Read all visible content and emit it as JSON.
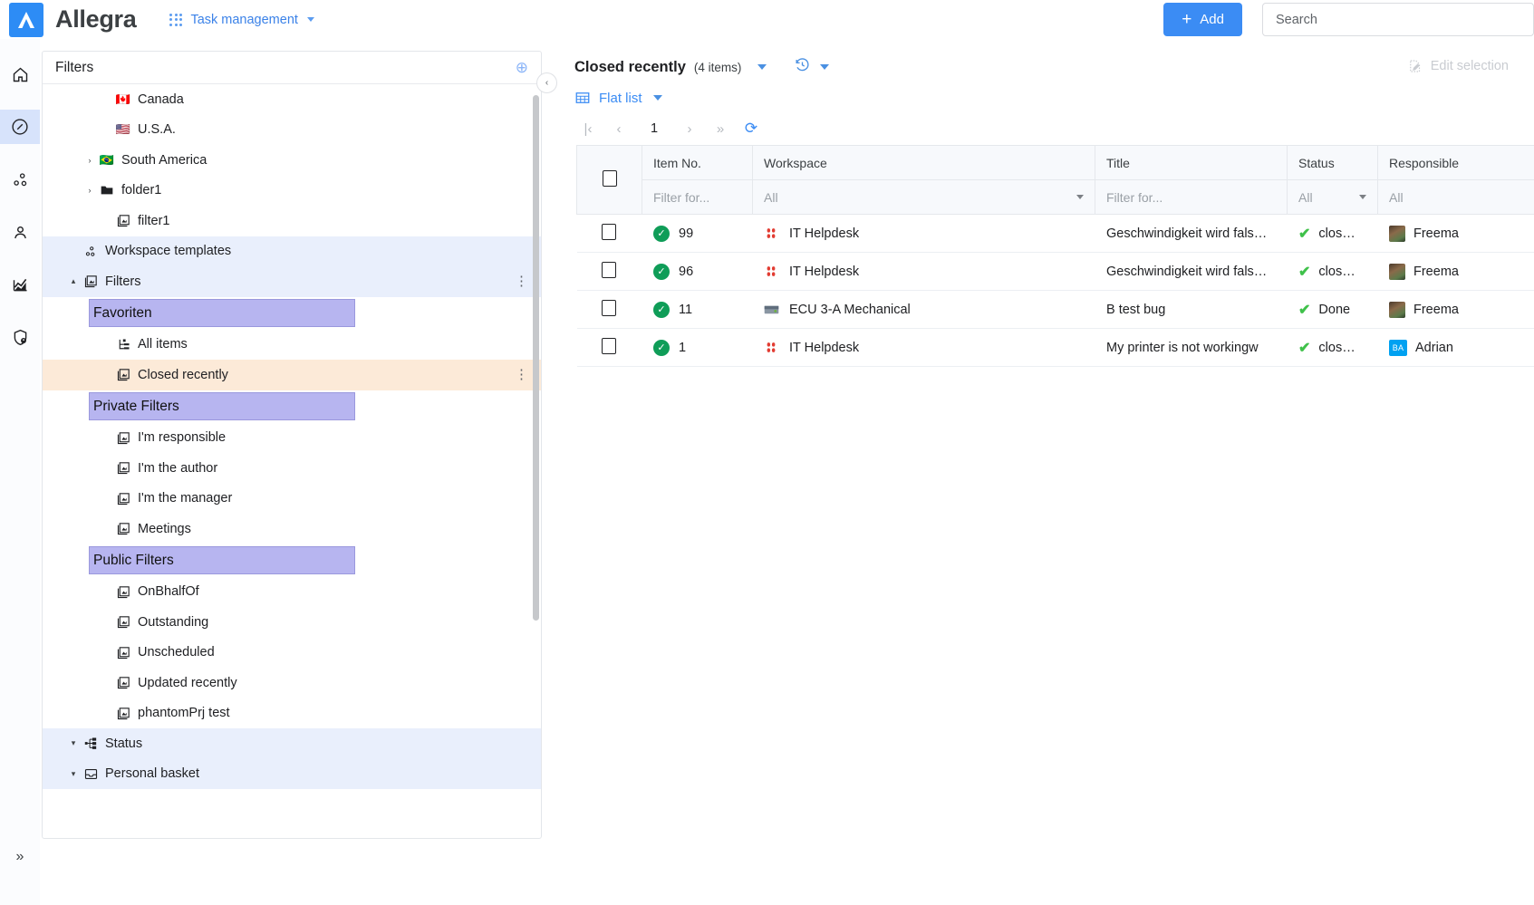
{
  "topbar": {
    "brand": "Allegra",
    "app_switcher_label": "Task management",
    "add_label": "Add",
    "add_plus": "+",
    "search_placeholder": "Search",
    "accent": "#3b8cf4"
  },
  "rail": {
    "items": [
      {
        "name": "home-icon",
        "label": "Home"
      },
      {
        "name": "compass-icon",
        "label": "Navigator",
        "active": true
      },
      {
        "name": "workflow-icon",
        "label": "Workspaces"
      },
      {
        "name": "person-icon",
        "label": "People"
      },
      {
        "name": "chart-icon",
        "label": "Reports"
      },
      {
        "name": "shield-icon",
        "label": "Admin"
      }
    ],
    "expand_glyph": "»"
  },
  "sidebar": {
    "title": "Filters",
    "add_glyph": "⊕",
    "collapse_glyph": "‹",
    "tree": [
      {
        "label": "Canada",
        "icon": "flag-canada",
        "indent": 3,
        "arrow": "",
        "type": "item"
      },
      {
        "label": "U.S.A.",
        "icon": "flag-usa",
        "indent": 3,
        "arrow": "",
        "type": "item"
      },
      {
        "label": "South America",
        "icon": "flag-brazil",
        "indent": 2,
        "arrow": "›",
        "type": "item"
      },
      {
        "label": "folder1",
        "icon": "folder-icon",
        "indent": 2,
        "arrow": "›",
        "type": "item"
      },
      {
        "label": "filter1",
        "icon": "filter-icon",
        "indent": 3,
        "arrow": "",
        "type": "item"
      },
      {
        "label": "Workspace templates",
        "icon": "templates-icon",
        "indent": 1,
        "arrow": "",
        "type": "group"
      },
      {
        "label": "Filters",
        "icon": "filter-icon",
        "indent": 1,
        "arrow": "▴",
        "type": "group",
        "menu": "⋮"
      },
      {
        "label": "Favoriten",
        "icon": "",
        "indent": 0,
        "arrow": "",
        "type": "chip"
      },
      {
        "label": "All items",
        "icon": "allitems-icon",
        "indent": 3,
        "arrow": "",
        "type": "item"
      },
      {
        "label": "Closed recently",
        "icon": "filter-icon",
        "indent": 3,
        "arrow": "",
        "type": "selected",
        "menu": "⋮"
      },
      {
        "label": "Private Filters",
        "icon": "",
        "indent": 0,
        "arrow": "",
        "type": "chip"
      },
      {
        "label": "I'm responsible",
        "icon": "filter-icon",
        "indent": 3,
        "arrow": "",
        "type": "item"
      },
      {
        "label": "I'm the author",
        "icon": "filter-icon",
        "indent": 3,
        "arrow": "",
        "type": "item"
      },
      {
        "label": "I'm the manager",
        "icon": "filter-icon",
        "indent": 3,
        "arrow": "",
        "type": "item"
      },
      {
        "label": "Meetings",
        "icon": "filter-icon",
        "indent": 3,
        "arrow": "",
        "type": "item"
      },
      {
        "label": "Public Filters",
        "icon": "",
        "indent": 0,
        "arrow": "",
        "type": "chip"
      },
      {
        "label": "OnBhalfOf",
        "icon": "filter-icon",
        "indent": 3,
        "arrow": "",
        "type": "item"
      },
      {
        "label": "Outstanding",
        "icon": "filter-icon",
        "indent": 3,
        "arrow": "",
        "type": "item"
      },
      {
        "label": "Unscheduled",
        "icon": "filter-icon",
        "indent": 3,
        "arrow": "",
        "type": "item"
      },
      {
        "label": "Updated recently",
        "icon": "filter-icon",
        "indent": 3,
        "arrow": "",
        "type": "item"
      },
      {
        "label": "phantomPrj test",
        "icon": "filter-icon",
        "indent": 3,
        "arrow": "",
        "type": "item"
      },
      {
        "label": "Status",
        "icon": "status-icon",
        "indent": 1,
        "arrow": "▾",
        "type": "group"
      },
      {
        "label": "Personal basket",
        "icon": "basket-icon",
        "indent": 1,
        "arrow": "▾",
        "type": "group"
      }
    ]
  },
  "main": {
    "title": "Closed recently",
    "count": "(4 items)",
    "history_icon": "history-icon",
    "edit_selection_label": "Edit selection",
    "view_mode": "Flat list",
    "pager": {
      "first": "|‹",
      "prev": "‹",
      "page": "1",
      "next": "›",
      "last": "»",
      "refresh": "⟳"
    },
    "table": {
      "columns": [
        "Item No.",
        "Workspace",
        "Title",
        "Status",
        "Responsible"
      ],
      "filters": {
        "item_no": "Filter for...",
        "workspace": "All",
        "title": "Filter for...",
        "status": "All",
        "responsible": "All"
      },
      "rows": [
        {
          "item_no": "99",
          "workspace": "IT Helpdesk",
          "workspace_icon": "helpdesk-icon",
          "title": "Geschwindigkeit wird fals…",
          "status": "clos…",
          "responsible": "Freema",
          "avatar_type": "photo",
          "avatar_initials": ""
        },
        {
          "item_no": "96",
          "workspace": "IT Helpdesk",
          "workspace_icon": "helpdesk-icon",
          "title": "Geschwindigkeit wird fals…",
          "status": "clos…",
          "responsible": "Freema",
          "avatar_type": "photo",
          "avatar_initials": ""
        },
        {
          "item_no": "11",
          "workspace": "ECU 3-A Mechanical",
          "workspace_icon": "mechanical-icon",
          "title": "B test bug",
          "status": "Done",
          "responsible": "Freema",
          "avatar_type": "photo",
          "avatar_initials": ""
        },
        {
          "item_no": "1",
          "workspace": "IT Helpdesk",
          "workspace_icon": "helpdesk-icon",
          "title": "My printer is not workingw",
          "status": "clos…",
          "responsible": "Adrian",
          "avatar_type": "initials",
          "avatar_initials": "BA"
        }
      ]
    }
  }
}
